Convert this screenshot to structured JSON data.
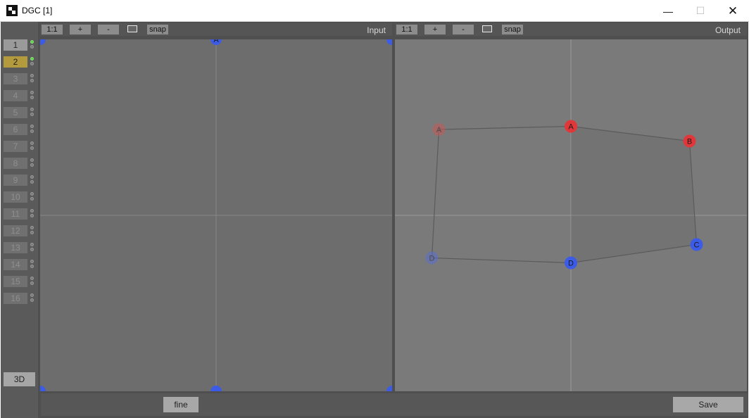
{
  "window": {
    "title": "DGC [1]",
    "minimize_glyph": "—",
    "maximize_glyph": "☐",
    "close_glyph": "✕"
  },
  "sidebar": {
    "slots": [
      {
        "label": "1",
        "state": "available",
        "indicators": [
          "on",
          "off"
        ]
      },
      {
        "label": "2",
        "state": "active",
        "indicators": [
          "on",
          "off"
        ]
      },
      {
        "label": "3",
        "state": "inactive",
        "indicators": [
          "off",
          "off"
        ]
      },
      {
        "label": "4",
        "state": "inactive",
        "indicators": [
          "off",
          "off"
        ]
      },
      {
        "label": "5",
        "state": "inactive",
        "indicators": [
          "off",
          "off"
        ]
      },
      {
        "label": "6",
        "state": "inactive",
        "indicators": [
          "off",
          "off"
        ]
      },
      {
        "label": "7",
        "state": "inactive",
        "indicators": [
          "off",
          "off"
        ]
      },
      {
        "label": "8",
        "state": "inactive",
        "indicators": [
          "off",
          "off"
        ]
      },
      {
        "label": "9",
        "state": "inactive",
        "indicators": [
          "off",
          "off"
        ]
      },
      {
        "label": "10",
        "state": "inactive",
        "indicators": [
          "off",
          "off"
        ]
      },
      {
        "label": "11",
        "state": "inactive",
        "indicators": [
          "off",
          "off"
        ]
      },
      {
        "label": "12",
        "state": "inactive",
        "indicators": [
          "off",
          "off"
        ]
      },
      {
        "label": "13",
        "state": "inactive",
        "indicators": [
          "off",
          "off"
        ]
      },
      {
        "label": "14",
        "state": "inactive",
        "indicators": [
          "off",
          "off"
        ]
      },
      {
        "label": "15",
        "state": "inactive",
        "indicators": [
          "off",
          "off"
        ]
      },
      {
        "label": "16",
        "state": "inactive",
        "indicators": [
          "off",
          "off"
        ]
      }
    ],
    "btn_3d": "3D"
  },
  "input_view": {
    "label": "Input",
    "toolbar": {
      "zoom_reset": "1:1",
      "zoom_in": "+",
      "zoom_out": "-",
      "snap": "snap"
    },
    "points": [
      {
        "label": "A",
        "u": 0.5,
        "v": 0.0
      },
      {
        "label": "",
        "u": 0.0,
        "v": 0.0
      },
      {
        "label": "",
        "u": 1.0,
        "v": 0.0
      },
      {
        "label": "",
        "u": 0.5,
        "v": 1.0
      },
      {
        "label": "",
        "u": 0.0,
        "v": 1.0
      },
      {
        "label": "",
        "u": 1.0,
        "v": 1.0
      }
    ]
  },
  "output_view": {
    "label": "Output",
    "toolbar": {
      "zoom_reset": "1:1",
      "zoom_in": "+",
      "zoom_out": "-",
      "snap": "snap"
    },
    "points": [
      {
        "label": "A",
        "u": 0.125,
        "v": 0.256,
        "color": "#c85555",
        "faded": true
      },
      {
        "label": "A",
        "u": 0.5,
        "v": 0.247,
        "color": "#e0383a",
        "faded": false
      },
      {
        "label": "B",
        "u": 0.837,
        "v": 0.289,
        "color": "#e0383a",
        "faded": false
      },
      {
        "label": "C",
        "u": 0.857,
        "v": 0.583,
        "color": "#3c5be6",
        "faded": false
      },
      {
        "label": "D",
        "u": 0.5,
        "v": 0.635,
        "color": "#3c5be6",
        "faded": false
      },
      {
        "label": "D",
        "u": 0.105,
        "v": 0.621,
        "color": "#5a6fd0",
        "faded": true
      }
    ]
  },
  "bottom": {
    "fine_label": "fine",
    "save_label": "Save"
  },
  "colors": {
    "accent_active_slot": "#b39a3c",
    "indicator_on": "#5bd642",
    "point_red": "#e0383a",
    "point_blue": "#3c5be6"
  }
}
